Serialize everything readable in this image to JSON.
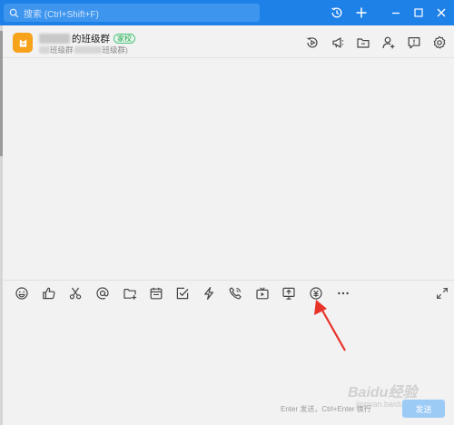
{
  "search": {
    "placeholder": "搜索 (Ctrl+Shift+F)",
    "icon": "search-icon"
  },
  "titlebar": {
    "background": "#1e81e8",
    "icons": [
      "history-icon",
      "plus-icon",
      "minimize-icon",
      "maximize-icon",
      "close-icon"
    ]
  },
  "chat": {
    "name_suffix": "的班级群",
    "badge": "家校",
    "subtitle_part1": "班级群",
    "subtitle_part2": "班级群)",
    "avatar_color": "#f6a21b",
    "header_icons": [
      "video-call-icon",
      "announcement-icon",
      "folder-icon",
      "add-member-icon",
      "feedback-icon",
      "settings-icon"
    ]
  },
  "toolbar": {
    "icons": [
      "emoji-icon",
      "thumbs-up-icon",
      "scissors-icon",
      "at-mention-icon",
      "folder-plus-icon",
      "calendar-icon",
      "checkbox-icon",
      "lightning-icon",
      "phone-icon",
      "live-icon",
      "screen-share-icon",
      "red-packet-icon",
      "more-icon"
    ],
    "expand_icon": "expand-icon"
  },
  "input": {
    "hint": "Enter 发送，Ctrl+Enter 换行",
    "send_label": "发送"
  },
  "watermark": {
    "main": "Baidu经验",
    "sub": "jingyan.baidu.com"
  },
  "annotation": {
    "color": "#e8332a"
  }
}
